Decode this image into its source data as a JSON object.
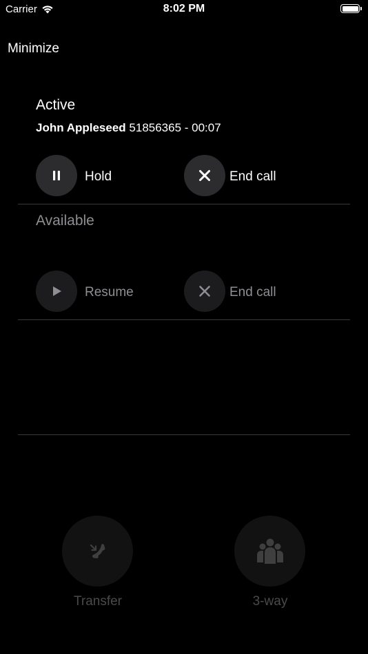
{
  "status_bar": {
    "carrier": "Carrier",
    "time": "8:02 PM",
    "battery_level": 1.0
  },
  "header": {
    "minimize_label": "Minimize"
  },
  "active_call": {
    "title": "Active",
    "caller_name": "John Appleseed",
    "caller_details": "51856365 - 00:07",
    "hold_label": "Hold",
    "end_call_label": "End call"
  },
  "available_call": {
    "title": "Available",
    "resume_label": "Resume",
    "end_call_label": "End call"
  },
  "actions": {
    "transfer_label": "Transfer",
    "three_way_label": "3-way"
  },
  "colors": {
    "background": "#000000",
    "button_bg": "#2c2c2e",
    "disabled_text": "#4a4a4a",
    "dimmed_text": "#8e8e93"
  }
}
